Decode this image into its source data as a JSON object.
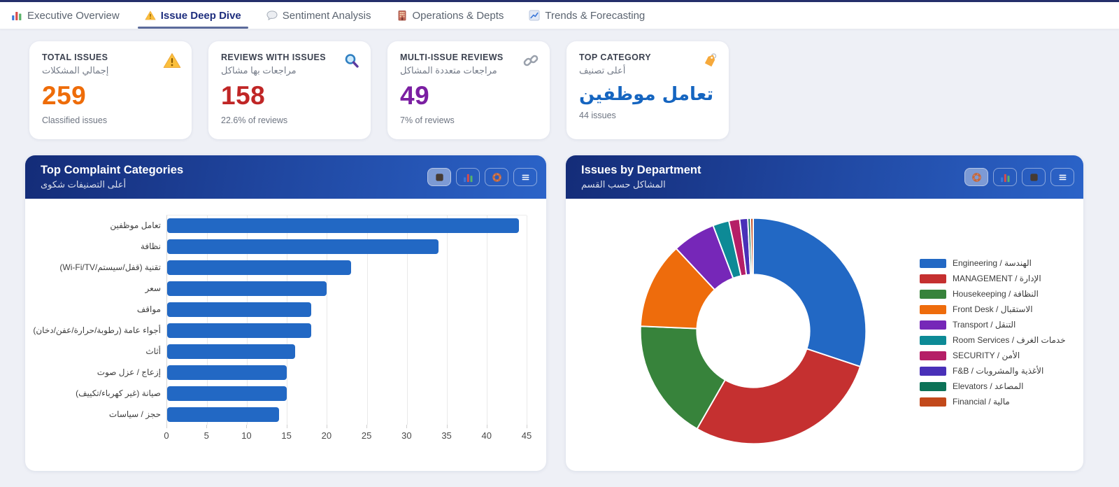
{
  "nav": {
    "tabs": [
      {
        "label": "Executive Overview",
        "icon": "bar-chart-icon",
        "active": false
      },
      {
        "label": "Issue Deep Dive",
        "icon": "warning-icon",
        "active": true
      },
      {
        "label": "Sentiment Analysis",
        "icon": "speech-bubble-icon",
        "active": false
      },
      {
        "label": "Operations & Depts",
        "icon": "building-icon",
        "active": false
      },
      {
        "label": "Trends & Forecasting",
        "icon": "trend-chart-icon",
        "active": false
      }
    ]
  },
  "kpi_cards": [
    {
      "label": "TOTAL ISSUES",
      "label_ar": "إجمالي المشكلات",
      "value": "259",
      "value_color": "#ee6c09",
      "value_arabic": false,
      "caption": "Classified issues",
      "icon": "warning-icon"
    },
    {
      "label": "REVIEWS WITH ISSUES",
      "label_ar": "مراجعات بها مشاكل",
      "value": "158",
      "value_color": "#c02626",
      "value_arabic": false,
      "caption": "22.6% of reviews",
      "icon": "magnifier-icon"
    },
    {
      "label": "MULTI-ISSUE REVIEWS",
      "label_ar": "مراجعات متعددة المشاكل",
      "value": "49",
      "value_color": "#7b1fa2",
      "value_arabic": false,
      "caption": "7% of reviews",
      "icon": "link-icon"
    },
    {
      "label": "TOP CATEGORY",
      "label_ar": "أعلى تصنيف",
      "value": "تعامل موظفين",
      "value_color": "#1565c0",
      "value_arabic": true,
      "caption": "44 issues",
      "icon": "tag-icon"
    }
  ],
  "panels": [
    {
      "title": "Top Complaint Categories",
      "subtitle_ar": "أعلى التصنيفات شكوى",
      "toolbar": [
        {
          "icon": "square-icon",
          "active": true
        },
        {
          "icon": "bar-chart-icon",
          "active": false
        },
        {
          "icon": "donut-icon",
          "active": false
        },
        {
          "icon": "menu-icon",
          "active": false
        }
      ]
    },
    {
      "title": "Issues by Department",
      "subtitle_ar": "المشاكل حسب القسم",
      "toolbar": [
        {
          "icon": "donut-icon",
          "active": true
        },
        {
          "icon": "bar-chart-icon",
          "active": false
        },
        {
          "icon": "square-icon",
          "active": false
        },
        {
          "icon": "menu-icon",
          "active": false
        }
      ]
    }
  ],
  "chart_data": [
    {
      "type": "bar",
      "orientation": "horizontal",
      "title": "Top Complaint Categories",
      "categories": [
        "تعامل موظفين",
        "نظافة",
        "تقنية (قفل/سيستم/Wi-Fi/TV)",
        "سعر",
        "مواقف",
        "أجواء عامة (رطوبة/حرارة/عفن/دخان)",
        "أثاث",
        "إزعاج / عزل صوت",
        "صيانة (غير كهرباء/تكييف)",
        "حجز / سياسات"
      ],
      "values": [
        44,
        34,
        23,
        20,
        18,
        18,
        16,
        15,
        15,
        14
      ],
      "xlim": [
        0,
        45
      ],
      "x_ticks": [
        0,
        5,
        10,
        15,
        20,
        25,
        30,
        35,
        40,
        45
      ],
      "bar_color": "#2268c4",
      "grid": true,
      "legend": false
    },
    {
      "type": "pie",
      "donut": true,
      "title": "Issues by Department",
      "labels": [
        "Engineering / الهندسة",
        "MANAGEMENT / الإدارة",
        "Housekeeping / النظافة",
        "Front Desk / الاستقبال",
        "Transport / التنقل",
        "Room Services / خدمات الغرف",
        "SECURITY / الأمن",
        "F&B / الأغذية والمشروبات",
        "Elevators / المصاعد",
        "Financial / مالية"
      ],
      "values": [
        78,
        73,
        45,
        32,
        16,
        6,
        4,
        3,
        1,
        1
      ],
      "colors": [
        "#2268c4",
        "#c53030",
        "#37833b",
        "#ee6c0c",
        "#7627b8",
        "#0d8a96",
        "#b51f67",
        "#4930b8",
        "#0c7257",
        "#c2491b"
      ],
      "legend_position": "right"
    }
  ],
  "theme": {
    "accent_navy": "#142c78",
    "accent_blue": "#2b63c8",
    "page_background": "#eef0f6",
    "tab_underline": "#5b6b9b"
  }
}
